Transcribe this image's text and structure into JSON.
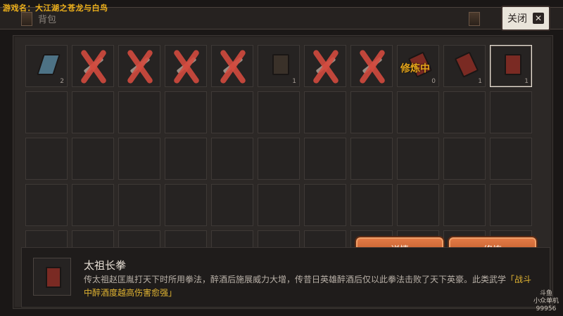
{
  "overlay": {
    "game_name": "游戏名：大江湖之苍龙与白鸟"
  },
  "header": {
    "title": "背包",
    "close_label": "关闭",
    "close_icon": "x-icon"
  },
  "inventory": {
    "items": [
      {
        "type": "book-blue",
        "count": "2",
        "crossed": false
      },
      {
        "type": "blade",
        "count": "",
        "crossed": true
      },
      {
        "type": "blade",
        "count": "",
        "crossed": true
      },
      {
        "type": "blade",
        "count": "",
        "crossed": true
      },
      {
        "type": "blade",
        "count": "",
        "crossed": true
      },
      {
        "type": "book-brown",
        "count": "1",
        "crossed": false
      },
      {
        "type": "blade",
        "count": "",
        "crossed": true
      },
      {
        "type": "blade",
        "count": "",
        "crossed": true
      },
      {
        "type": "book-red-tilt",
        "count": "0",
        "crossed": false,
        "status": "修炼中"
      },
      {
        "type": "book-red-tilt",
        "count": "1",
        "crossed": false
      },
      {
        "type": "book-red",
        "count": "1",
        "crossed": false,
        "selected": true
      }
    ]
  },
  "actions": {
    "details_label": "详情",
    "train_label": "修炼"
  },
  "detail": {
    "name": "太祖长拳",
    "description": "传太祖赵匡胤打天下时所用拳法，醉酒后施展威力大增，传昔日英雄醉酒后仅以此拳法击败了天下英豪。此类武学",
    "effect": "「战斗中醉酒度越高伤害愈强」"
  },
  "watermark": {
    "line1": "斗鱼",
    "line2": "小众单机",
    "line3": "99956"
  }
}
